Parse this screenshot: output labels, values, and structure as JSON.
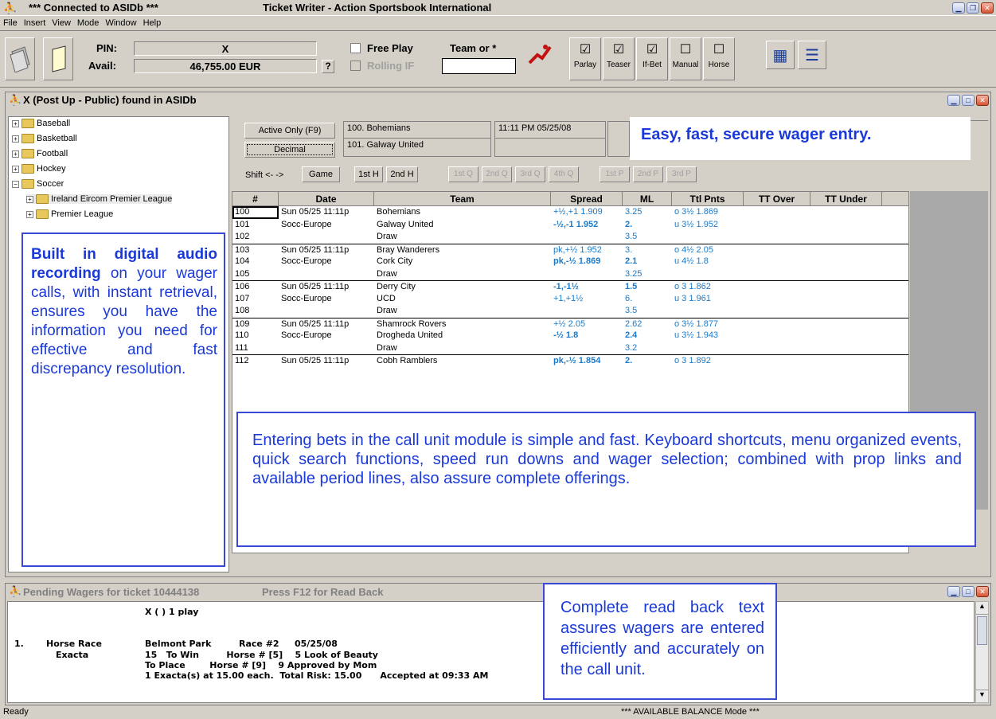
{
  "titlebar": {
    "connection": "***  Connected to ASIDb  ***",
    "app_title": "Ticket Writer - Action Sportsbook International"
  },
  "menu": [
    "File",
    "Insert",
    "View",
    "Mode",
    "Window",
    "Help"
  ],
  "toolbar": {
    "pin_label": "PIN:",
    "pin_value": "X",
    "avail_label": "Avail:",
    "avail_value": "46,755.00 EUR",
    "help_btn": "?",
    "free_play": "Free Play",
    "rolling_if": "Rolling IF",
    "team_label": "Team or *",
    "team_value": "",
    "bet_types": [
      "Parlay",
      "Teaser",
      "If-Bet",
      "Manual",
      "Horse"
    ]
  },
  "window1": {
    "title": "X (Post Up - Public)  found in ASIDb"
  },
  "tree": {
    "items": [
      "Baseball",
      "Basketball",
      "Football",
      "Hockey",
      "Soccer",
      "Ireland Eircom Premier League",
      "Premier League"
    ]
  },
  "callouts": {
    "left_bold": "Built in digital audio recording",
    "left_rest": "on your wager calls, with instant retrieval, ensures you have the information you need for effective and fast discrepancy resolution.",
    "top_right": "Easy, fast, secure wager entry.",
    "middle": "Entering bets in the call unit module is simple and fast. Keyboard shortcuts, menu organized events, quick search functions, speed run downs and wager selection; combined with prop links and available period lines, also assure complete offerings.",
    "bottom": "Complete read back text assures wagers are entered efficiently and accurately on the call unit."
  },
  "controls": {
    "active_only": "Active Only (F9)",
    "decimal": "Decimal",
    "event1": "100.  Bohemians",
    "event2": "101.  Galway United",
    "event_time": "11:11 PM  05/25/08",
    "shift": "Shift  <-  ->",
    "periods": [
      "Game",
      "1st H",
      "2nd H",
      "1st Q",
      "2nd Q",
      "3rd Q",
      "4th Q",
      "1st P",
      "2nd P",
      "3rd P"
    ]
  },
  "grid": {
    "columns": [
      "#",
      "Date",
      "Team",
      "Spread",
      "ML",
      "Ttl Pnts",
      "TT Over",
      "TT Under"
    ],
    "rows": [
      {
        "num": "100",
        "date": "Sun 05/25 11:11p",
        "team": "Bohemians",
        "spread": "+½,+1  1.909",
        "ml": "3.25",
        "ttl": "o 3½  1.869",
        "bold": false,
        "sep": false
      },
      {
        "num": "101",
        "date": "Socc-Europe",
        "team": "Galway United",
        "spread": "-½,-1  1.952",
        "ml": "2.",
        "ttl": "u 3½  1.952",
        "bold": true,
        "sep": false
      },
      {
        "num": "102",
        "date": "",
        "team": "Draw",
        "spread": "",
        "ml": "3.5",
        "ttl": "",
        "bold": false,
        "sep": false
      },
      {
        "num": "103",
        "date": "Sun 05/25 11:11p",
        "team": "Bray Wanderers",
        "spread": "pk,+½  1.952",
        "ml": "3.",
        "ttl": "o 4½  2.05",
        "bold": false,
        "sep": true
      },
      {
        "num": "104",
        "date": "Socc-Europe",
        "team": "Cork City",
        "spread": "pk,-½  1.869",
        "ml": "2.1",
        "ttl": "u 4½  1.8",
        "bold": true,
        "sep": false
      },
      {
        "num": "105",
        "date": "",
        "team": "Draw",
        "spread": "",
        "ml": "3.25",
        "ttl": "",
        "bold": false,
        "sep": false
      },
      {
        "num": "106",
        "date": "Sun 05/25 11:11p",
        "team": "Derry City",
        "spread": "-1,-1½",
        "ml": "1.5",
        "ttl": "o 3  1.862",
        "bold": true,
        "sep": true
      },
      {
        "num": "107",
        "date": "Socc-Europe",
        "team": "UCD",
        "spread": "+1,+1½",
        "ml": "6.",
        "ttl": "u 3  1.961",
        "bold": false,
        "sep": false
      },
      {
        "num": "108",
        "date": "",
        "team": "Draw",
        "spread": "",
        "ml": "3.5",
        "ttl": "",
        "bold": false,
        "sep": false
      },
      {
        "num": "109",
        "date": "Sun 05/25 11:11p",
        "team": "Shamrock Rovers",
        "spread": "+½  2.05",
        "ml": "2.62",
        "ttl": "o 3½  1.877",
        "bold": false,
        "sep": true
      },
      {
        "num": "110",
        "date": "Socc-Europe",
        "team": "Drogheda United",
        "spread": "-½  1.8",
        "ml": "2.4",
        "ttl": "u 3½  1.943",
        "bold": true,
        "sep": false
      },
      {
        "num": "111",
        "date": "",
        "team": "Draw",
        "spread": "",
        "ml": "3.2",
        "ttl": "",
        "bold": false,
        "sep": false
      },
      {
        "num": "112",
        "date": "Sun 05/25 11:11p",
        "team": "Cobh Ramblers",
        "spread": "pk,-½  1.854",
        "ml": "2.",
        "ttl": "o 3  1.892",
        "bold": true,
        "sep": true
      }
    ]
  },
  "pending": {
    "title": "Pending Wagers for ticket 10444138",
    "readback_hint": "Press F12 for Read Back",
    "line1": "X  ( )       1 play",
    "num": "1.",
    "type1": "Horse Race",
    "type2": "Exacta",
    "track": "Belmont Park",
    "race": "Race #2",
    "date": "05/25/08",
    "l2": "15   To Win         Horse # [5]    5 Look of Beauty",
    "l3": "To Place        Horse # [9]    9 Approved by Mom",
    "l4": "1 Exacta(s) at 15.00 each.  Total Risk: 15.00      Accepted at 09:33 AM"
  },
  "status": {
    "left": "Ready",
    "center": "*** AVAILABLE BALANCE Mode ***"
  }
}
